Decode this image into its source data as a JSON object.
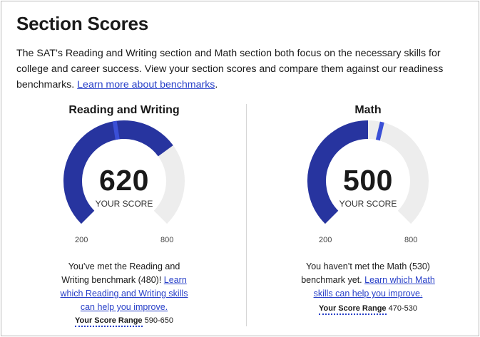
{
  "page": {
    "title": "Section Scores",
    "intro": "The SAT’s Reading and Writing section and Math section both focus on the necessary skills for college and career success. View your section scores and compare them against our readiness benchmarks.",
    "intro_link": "Learn more about benchmarks",
    "intro_link_end": "."
  },
  "sections": [
    {
      "name": "Reading and Writing",
      "score": 620,
      "score_label": "YOUR SCORE",
      "min": 200,
      "max": 800,
      "benchmark": 480,
      "message": "You’ve met the Reading and Writing benchmark (480)!",
      "link": "Learn which Reading and Writing skills can help you improve.",
      "range_label": "Your Score Range",
      "range_value": "590-650"
    },
    {
      "name": "Math",
      "score": 500,
      "score_label": "YOUR SCORE",
      "min": 200,
      "max": 800,
      "benchmark": 530,
      "message": "You haven’t met the Math (530) benchmark yet.",
      "link": "Learn which Math skills can help you improve.",
      "range_label": "Your Score Range",
      "range_value": "470-530"
    }
  ],
  "colors": {
    "fill": "#27349f",
    "benchmark_marker": "#3a4fd6",
    "track": "#ededed",
    "link": "#2840c8"
  }
}
